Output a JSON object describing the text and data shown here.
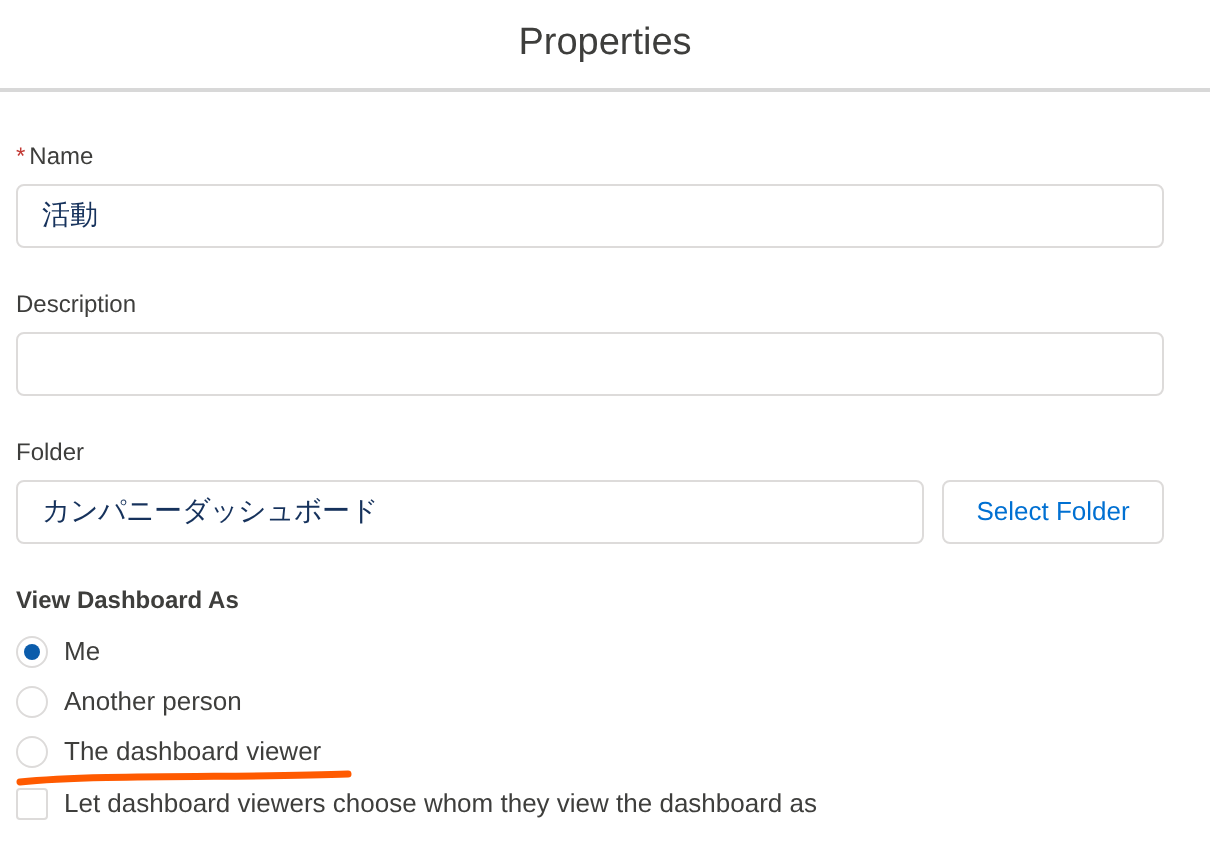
{
  "header": {
    "title": "Properties"
  },
  "fields": [
    {
      "kind": "text",
      "label": "Name",
      "required_mark": "*",
      "value": "活動"
    },
    {
      "kind": "text",
      "label": "Description"
    },
    {
      "kind": "folder",
      "label": "Folder",
      "value": "カンパニーダッシュボード",
      "button": "Select Folder"
    }
  ],
  "view_as": {
    "label": "View Dashboard As",
    "options": [
      {
        "label": "Me",
        "selected": true
      },
      {
        "label": "Another person",
        "selected": false
      },
      {
        "label": "The dashboard viewer",
        "selected": false,
        "underlined": true
      }
    ]
  },
  "let_viewers_choose": {
    "label": "Let dashboard viewers choose whom they view the dashboard as",
    "checked": false
  }
}
